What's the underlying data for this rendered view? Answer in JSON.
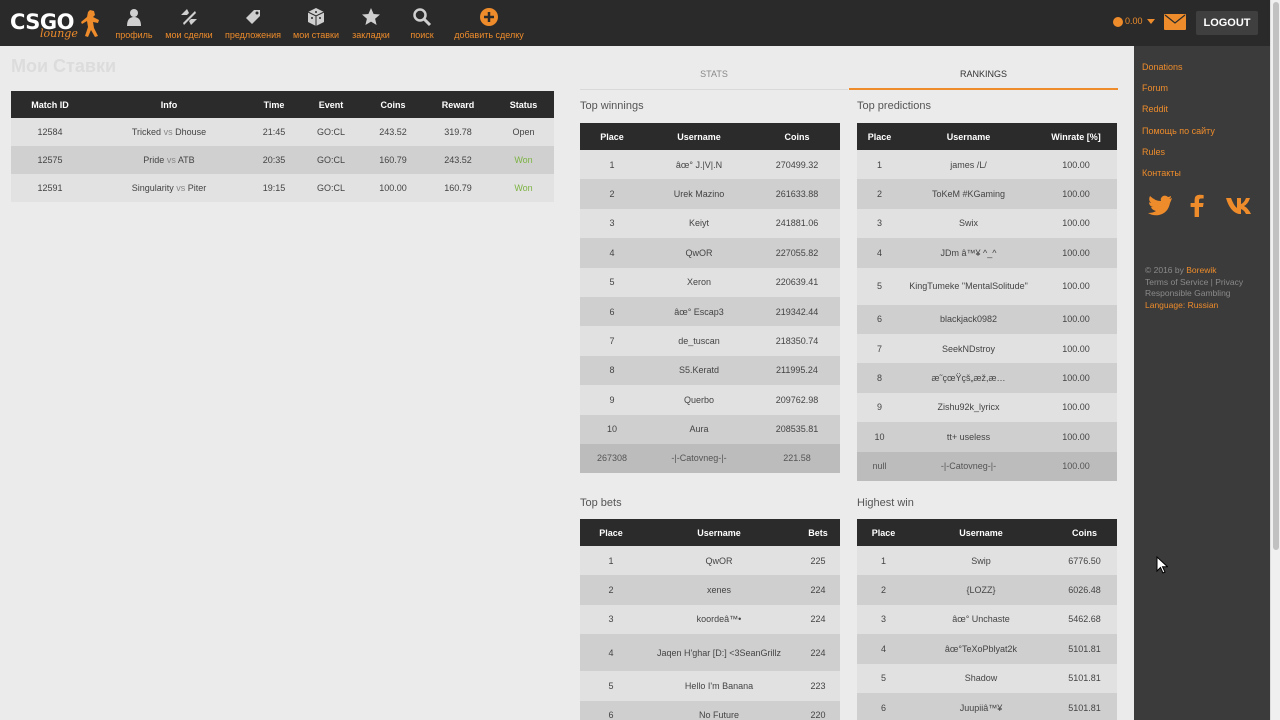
{
  "nav": {
    "logo_text": "CSGO",
    "logo_sub": "lounge",
    "items": [
      {
        "label": "профиль",
        "icon": "profile-icon"
      },
      {
        "label": "мои сделки",
        "icon": "trades-icon"
      },
      {
        "label": "предложения",
        "icon": "tag-icon"
      },
      {
        "label": "мои ставки",
        "icon": "dice-icon"
      },
      {
        "label": "закладки",
        "icon": "star-icon"
      },
      {
        "label": "поиск",
        "icon": "search-icon"
      },
      {
        "label": "добавить сделку",
        "icon": "plus-circle-icon"
      }
    ],
    "coins": "0.00",
    "logout": "LOGOUT"
  },
  "mybets": {
    "title": "Мои Ставки",
    "headers": [
      "Match ID",
      "Info",
      "Time",
      "Event",
      "Coins",
      "Reward",
      "Status"
    ],
    "rows": [
      {
        "id": "12584",
        "team1": "Tricked",
        "team2": "Dhouse",
        "time": "21:45",
        "event": "GO:CL",
        "coins": "243.52",
        "reward": "319.78",
        "status": "Open"
      },
      {
        "id": "12575",
        "team1": "Pride",
        "team2": "ATB",
        "time": "20:35",
        "event": "GO:CL",
        "coins": "160.79",
        "reward": "243.52",
        "status": "Won"
      },
      {
        "id": "12591",
        "team1": "Singularity",
        "team2": "Piter",
        "time": "19:15",
        "event": "GO:CL",
        "coins": "100.00",
        "reward": "160.79",
        "status": "Won"
      }
    ],
    "vs": "vs"
  },
  "tabs": {
    "stats": "STATS",
    "rankings": "RANKINGS"
  },
  "top_winnings": {
    "title": "Top winnings",
    "headers": [
      "Place",
      "Username",
      "Coins"
    ],
    "rows": [
      [
        "1",
        "âœ° J.|V|.N",
        "270499.32"
      ],
      [
        "2",
        "Urek Mazino",
        "261633.88"
      ],
      [
        "3",
        "Keiyt",
        "241881.06"
      ],
      [
        "4",
        "QwOR",
        "227055.82"
      ],
      [
        "5",
        "Xeron",
        "220639.41"
      ],
      [
        "6",
        "âœ° Escap3",
        "219342.44"
      ],
      [
        "7",
        "de_tuscan",
        "218350.74"
      ],
      [
        "8",
        "S5.Keratd",
        "211995.24"
      ],
      [
        "9",
        "Querbo",
        "209762.98"
      ],
      [
        "10",
        "Aura",
        "208535.81"
      ]
    ],
    "user": [
      "267308",
      "-|-Catovneg-|-",
      "221.58"
    ]
  },
  "top_predictions": {
    "title": "Top predictions",
    "headers": [
      "Place",
      "Username",
      "Winrate [%]"
    ],
    "rows": [
      [
        "1",
        "james /L/",
        "100.00"
      ],
      [
        "2",
        "ToKeM #KGaming",
        "100.00"
      ],
      [
        "3",
        "Swix",
        "100.00"
      ],
      [
        "4",
        "JDm â™¥ ^_^",
        "100.00"
      ],
      [
        "5",
        "KingTumeke \"MentalSolitude\"",
        "100.00"
      ],
      [
        "6",
        "blackjack0982",
        "100.00"
      ],
      [
        "7",
        "SeekNDstroy",
        "100.00"
      ],
      [
        "8",
        "æ˜çœŸçš„æž,æ…",
        "100.00"
      ],
      [
        "9",
        "Zishu92k_lyricx",
        "100.00"
      ],
      [
        "10",
        "tt+ useless",
        "100.00"
      ]
    ],
    "user": [
      "null",
      "-|-Catovneg-|-",
      "100.00"
    ]
  },
  "top_bets": {
    "title": "Top bets",
    "headers": [
      "Place",
      "Username",
      "Bets"
    ],
    "rows": [
      [
        "1",
        "QwOR",
        "225"
      ],
      [
        "2",
        "xenes",
        "224"
      ],
      [
        "3",
        "koordeâ™•",
        "224"
      ],
      [
        "4",
        "Jaqen H'ghar [D:] <3SeanGrillz",
        "224"
      ],
      [
        "5",
        "Hello I'm Banana",
        "223"
      ],
      [
        "6",
        "No Future",
        "220"
      ]
    ]
  },
  "highest_win": {
    "title": "Highest win",
    "headers": [
      "Place",
      "Username",
      "Coins"
    ],
    "rows": [
      [
        "1",
        "Swip",
        "6776.50"
      ],
      [
        "2",
        "{LOZZ}",
        "6026.48"
      ],
      [
        "3",
        "âœ° Unchaste",
        "5462.68"
      ],
      [
        "4",
        "âœ°TeXoPblyat2k",
        "5101.81"
      ],
      [
        "5",
        "Shadow",
        "5101.81"
      ],
      [
        "6",
        "Juupiiâ™¥",
        "5101.81"
      ]
    ]
  },
  "sidebar": {
    "links": [
      "Donations",
      "Forum",
      "Reddit",
      "Помощь по сайту",
      "Rules",
      "Контакты"
    ],
    "social": [
      "twitter-icon",
      "facebook-icon",
      "vk-icon"
    ],
    "footer": {
      "copyright": "© 2016 by",
      "author": "Borewik",
      "terms": "Terms of Service",
      "privacy": "Privacy",
      "gambling": "Responsible Gambling",
      "language_label": "Language:",
      "language": "Russian"
    }
  },
  "colors": {
    "accent": "#ee8c2b",
    "topbar": "#2a2a2a",
    "sidebar": "#3b3b3b",
    "won": "#7cb342"
  }
}
